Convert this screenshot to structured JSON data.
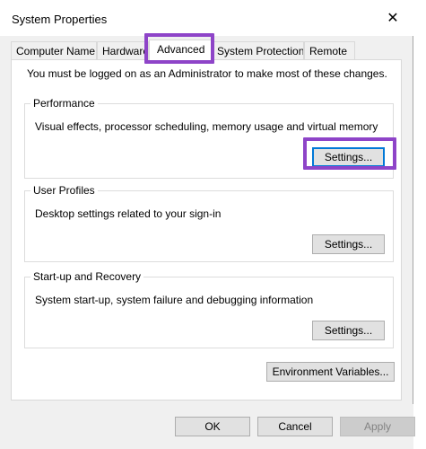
{
  "window": {
    "title": "System Properties",
    "close_glyph": "✕"
  },
  "tabs": [
    {
      "label": "Computer Name",
      "active": false
    },
    {
      "label": "Hardware",
      "active": false
    },
    {
      "label": "Advanced",
      "active": true
    },
    {
      "label": "System Protection",
      "active": false
    },
    {
      "label": "Remote",
      "active": false
    }
  ],
  "advanced": {
    "admin_note": "You must be logged on as an Administrator to make most of these changes.",
    "performance": {
      "label": "Performance",
      "description": "Visual effects, processor scheduling, memory usage and virtual memory",
      "button": "Settings..."
    },
    "user_profiles": {
      "label": "User Profiles",
      "description": "Desktop settings related to your sign-in",
      "button": "Settings..."
    },
    "startup_recovery": {
      "label": "Start-up and Recovery",
      "description": "System start-up, system failure and debugging information",
      "button": "Settings..."
    },
    "env_vars_button": "Environment Variables..."
  },
  "footer": {
    "ok": "OK",
    "cancel": "Cancel",
    "apply": "Apply"
  },
  "colors": {
    "highlight": "#8e44c8",
    "focus": "#0078d7"
  }
}
